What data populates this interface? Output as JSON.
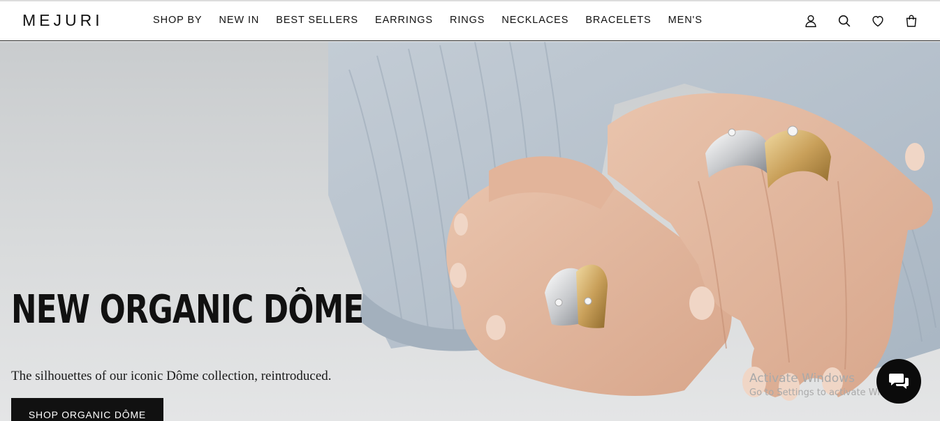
{
  "brand": {
    "logo": "MEJURI"
  },
  "nav": {
    "items": [
      "SHOP BY",
      "NEW IN",
      "BEST SELLERS",
      "EARRINGS",
      "RINGS",
      "NECKLACES",
      "BRACELETS",
      "MEN'S"
    ]
  },
  "header_icons": [
    "account-icon",
    "search-icon",
    "wishlist-heart-icon",
    "shopping-bag-icon"
  ],
  "hero": {
    "title": "NEW ORGANIC DÔME",
    "subtitle": "The silhouettes of our iconic Dôme collection, reintroduced.",
    "cta_label": "SHOP ORGANIC DÔME"
  },
  "system_overlay": {
    "line1": "Activate Windows",
    "line2": "Go to Settings to activate Windows."
  },
  "chat": {
    "icon": "chat-bubbles-icon"
  },
  "colors": {
    "text": "#111111",
    "cta_background": "#111111",
    "cta_text": "#ffffff",
    "sweater": "#b8c4d1",
    "skin": "#e3b9a0",
    "background_surface": "#dcdedf"
  }
}
